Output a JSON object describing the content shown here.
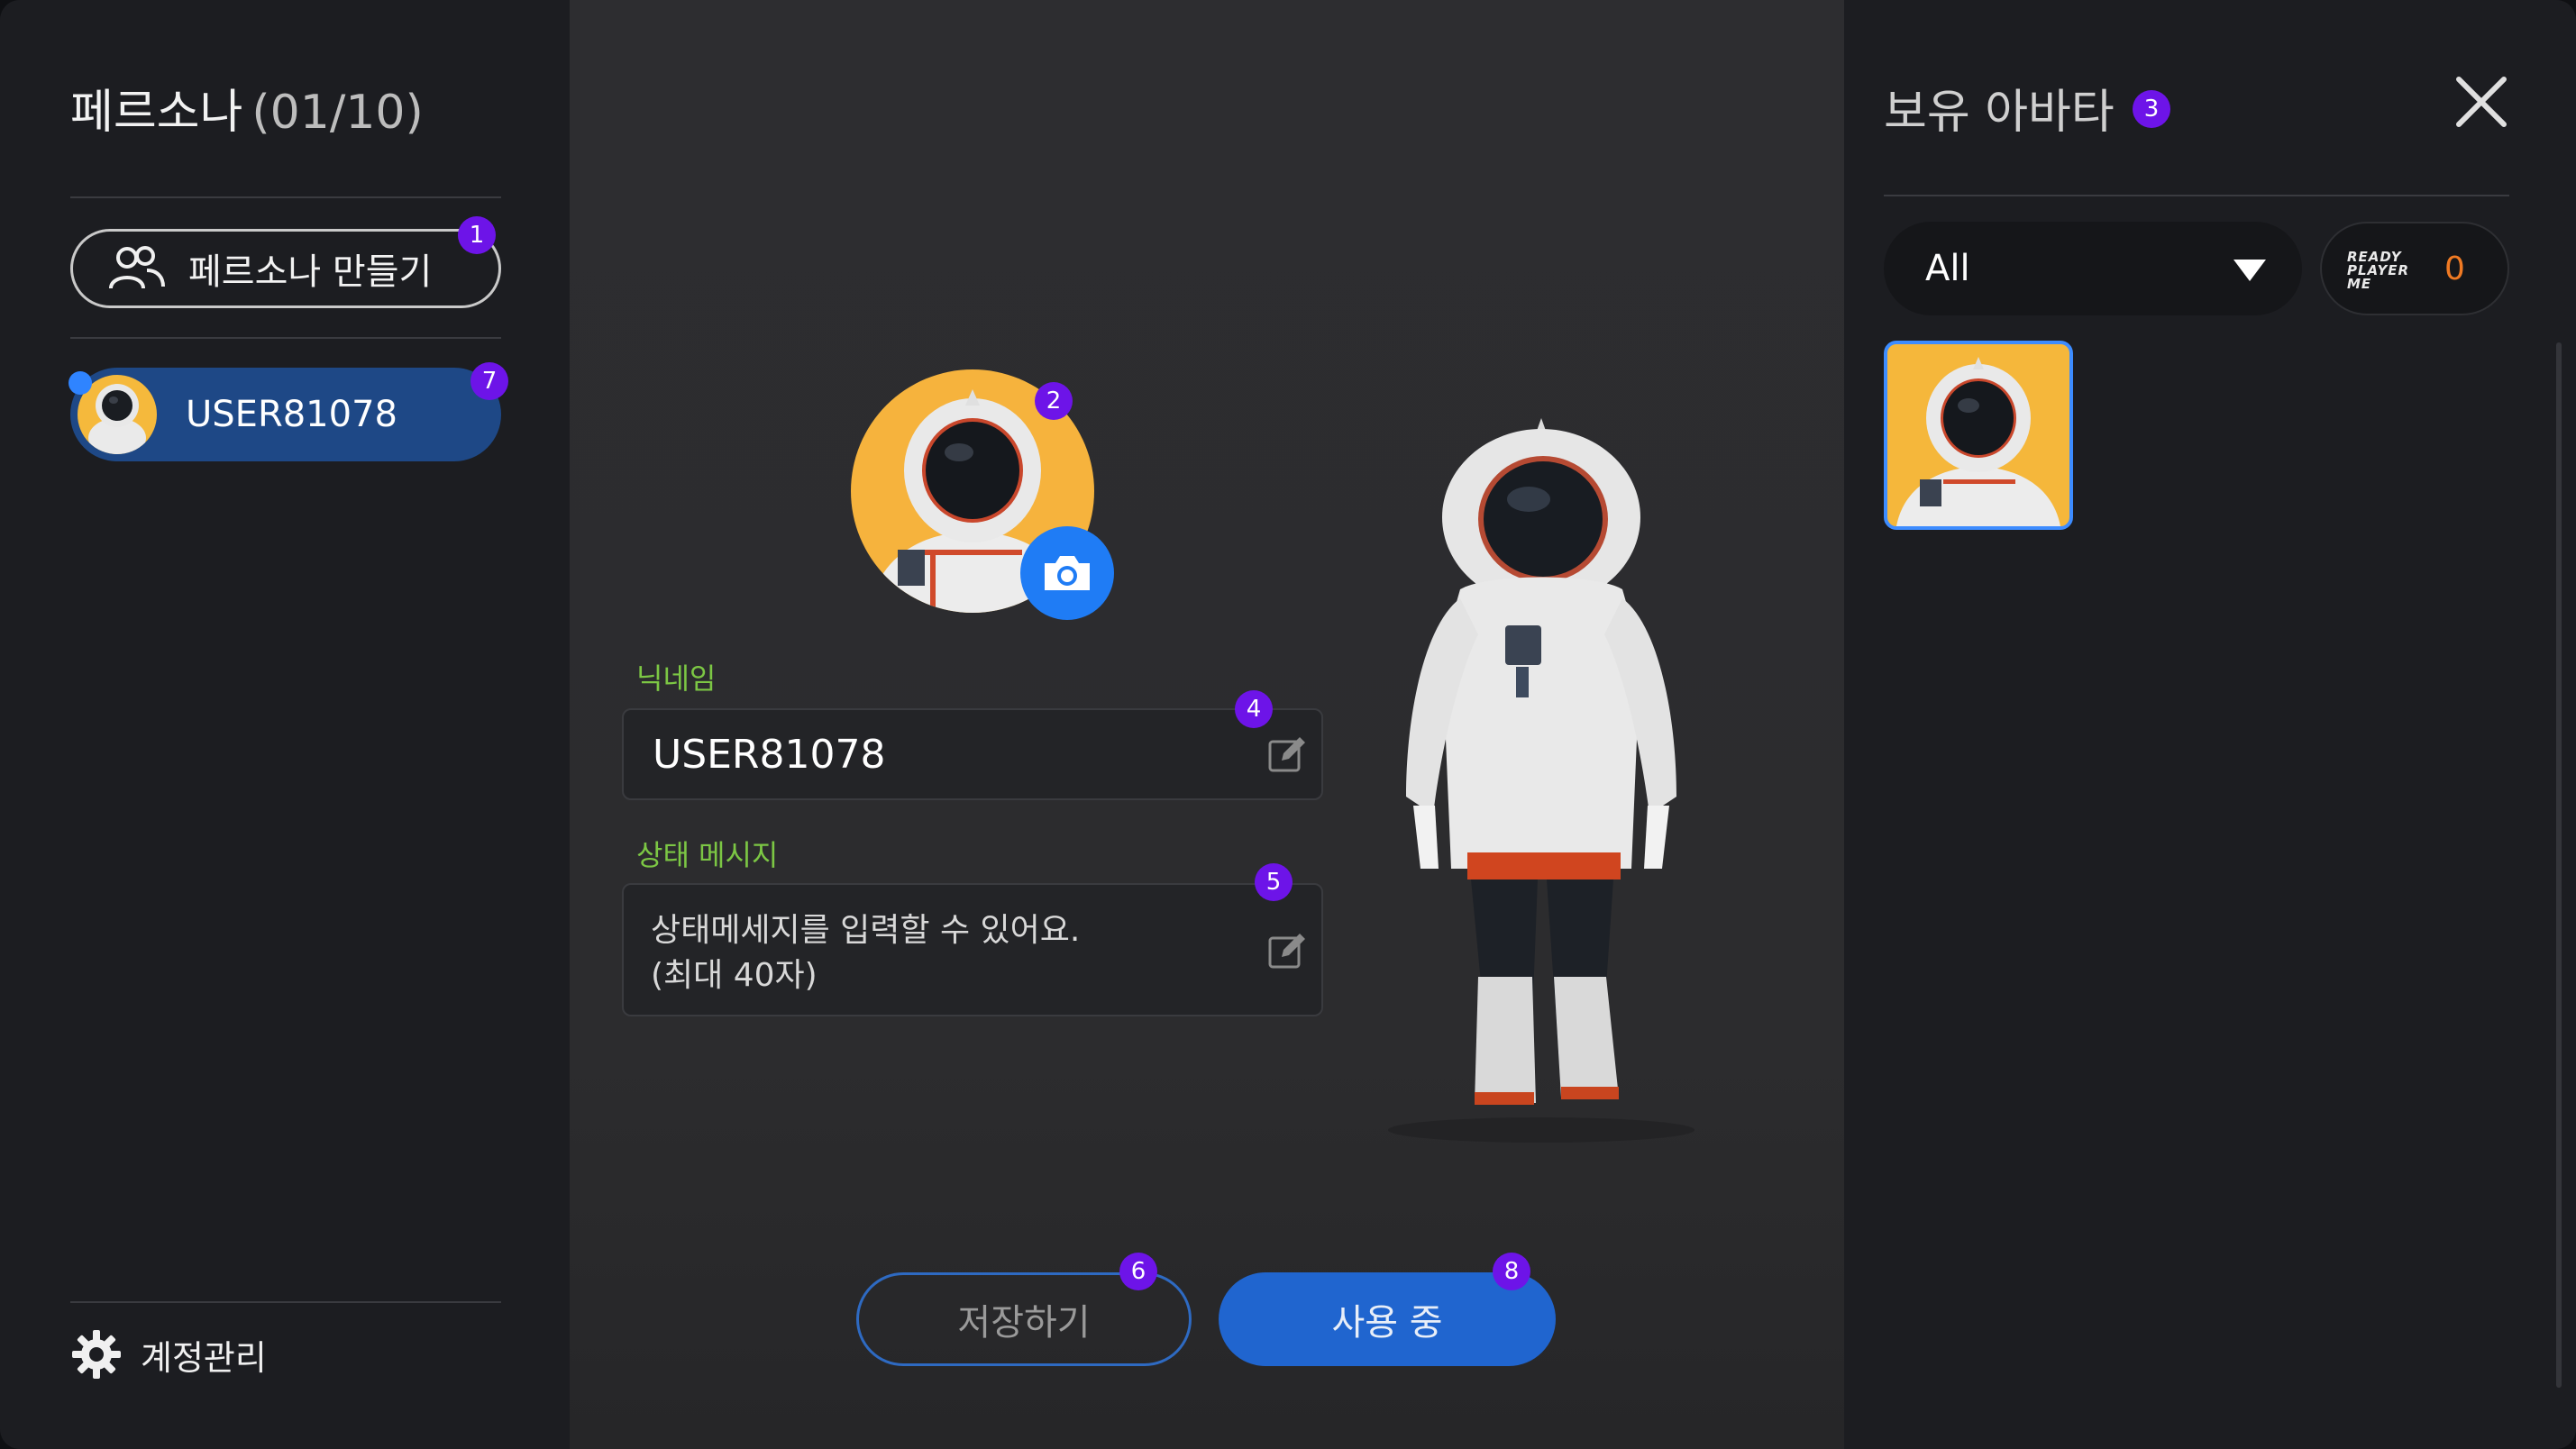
{
  "left": {
    "title": "페르소나",
    "count": "(01/10)",
    "create_button": "페르소나 만들기",
    "persona_name": "USER81078",
    "account_label": "계정관리"
  },
  "center": {
    "nickname_label": "닉네임",
    "nickname_value": "USER81078",
    "status_label": "상태 메시지",
    "status_placeholder": "상태메세지를 입력할 수 있어요.\n(최대 40자)",
    "save_button": "저장하기",
    "use_button": "사용 중"
  },
  "right": {
    "title": "보유 아바타",
    "filter_value": "All",
    "rpm_logo": "READY PLAYER ME",
    "rpm_count": "0"
  },
  "badges": [
    "1",
    "2",
    "3",
    "4",
    "5",
    "6",
    "7",
    "8"
  ],
  "colors": {
    "accent_blue": "#2065cf",
    "badge_purple": "#6d14e8",
    "label_green": "#7cc744",
    "avatar_bg": "#f5b73b",
    "rpm_count": "#f07a23"
  },
  "icons": [
    "people-icon",
    "gear-icon",
    "camera-icon",
    "edit-icon",
    "close-icon",
    "caret-down-icon"
  ]
}
